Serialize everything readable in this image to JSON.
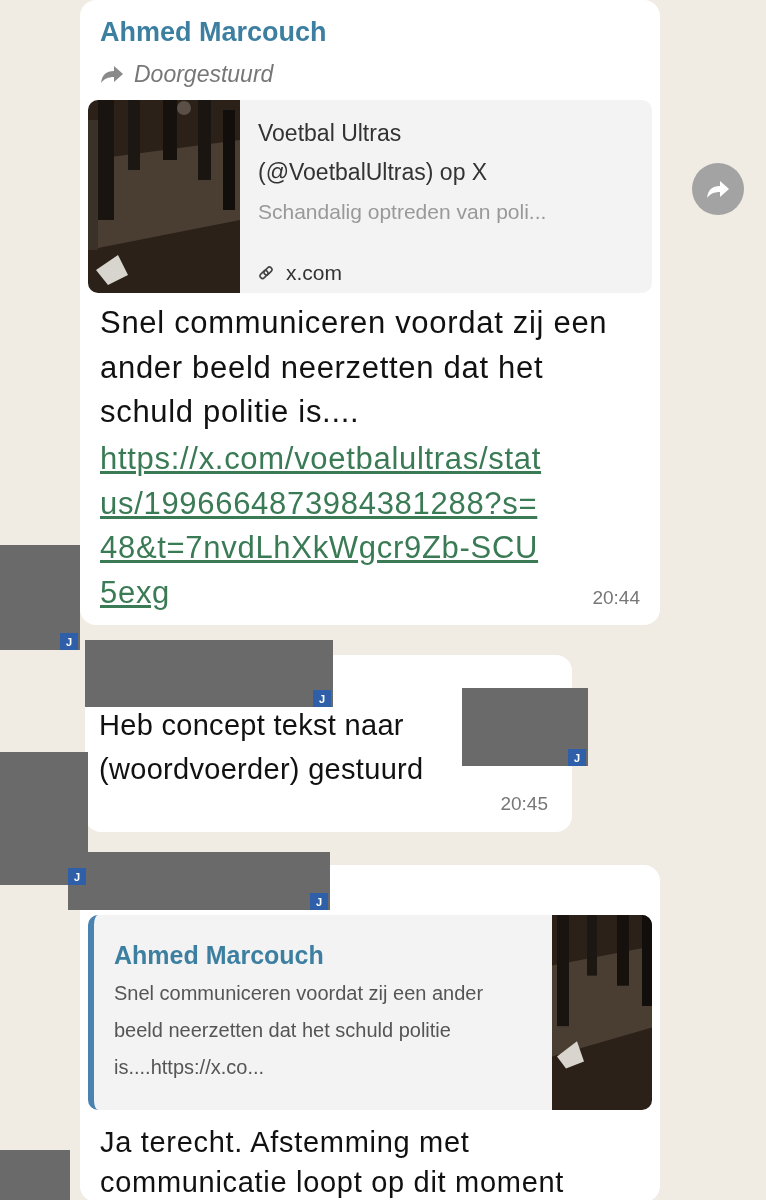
{
  "messages": [
    {
      "kind": "forwarded",
      "sender": "Ahmed Marcouch",
      "forwarded_label": "Doorgestuurd",
      "preview": {
        "title": "Voetbal Ultras (@VoetbalUltras) op X",
        "description": "Schandalig optreden van poli...",
        "domain": "x.com"
      },
      "text": "Snel communiceren voordat zij een ander beeld neerzetten dat het schuld politie is....",
      "link": "https://x.com/voetbalultras/status/1996664873984381288?s=48&t=7nvdLhXkWgcr9Zb-SCU5exg",
      "time": "20:44"
    },
    {
      "kind": "plain",
      "text": "Heb concept tekst naar (woordvoerder) gestuurd",
      "time": "20:45"
    },
    {
      "kind": "reply",
      "quote": {
        "sender": "Ahmed Marcouch",
        "text": "Snel communiceren voordat zij een ander beeld neerzetten dat het schuld politie is....https://x.co..."
      },
      "text": "Ja terecht. Afstemming met communicatie loopt op dit moment"
    }
  ],
  "redactions": [
    {
      "kind": "badged",
      "badge": "J"
    },
    {
      "kind": "badged",
      "badge": "J"
    },
    {
      "kind": "badged",
      "badge": "J"
    },
    {
      "kind": "badged",
      "badge": "J"
    },
    {
      "kind": "badged",
      "badge": "J"
    },
    {
      "kind": "plain"
    }
  ]
}
